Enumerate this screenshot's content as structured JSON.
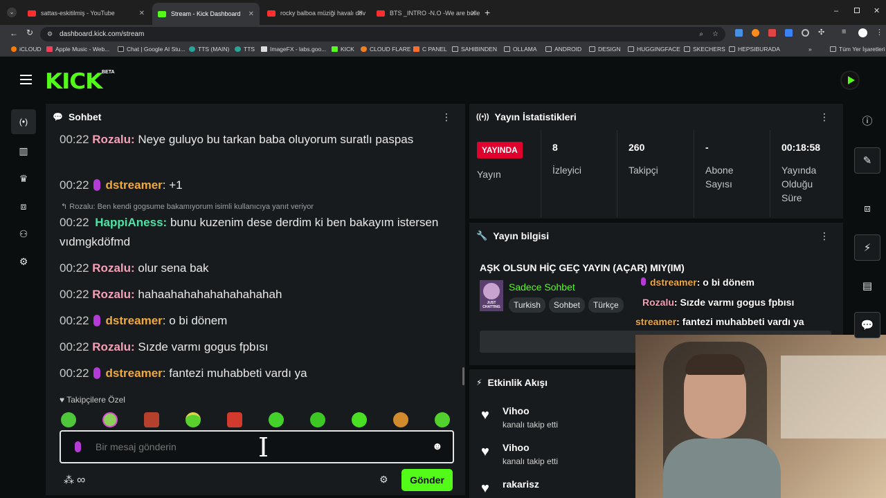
{
  "browser": {
    "tabs": [
      {
        "title": "sattas-eskitilmiş - YouTube",
        "color": "#ff2d2d"
      },
      {
        "title": "Stream - Kick Dashboard",
        "color": "#53fc18"
      },
      {
        "title": "rocky balboa müziği havalı döv",
        "color": "#ff2d2d"
      },
      {
        "title": "BTS _INTRO -N.O -We are bulle",
        "color": "#ff2d2d"
      }
    ],
    "url": "dashboard.kick.com/stream",
    "bookmarks": [
      {
        "label": "iCLOUD"
      },
      {
        "label": "Apple Music - Web..."
      },
      {
        "label": "Chat | Google AI Stu..."
      },
      {
        "label": "TTS (MAIN)"
      },
      {
        "label": "TTS"
      },
      {
        "label": "ImageFX - labs.goo..."
      },
      {
        "label": "KICK"
      },
      {
        "label": "CLOUD FLARE"
      },
      {
        "label": "C PANEL"
      },
      {
        "label": "SAHIBINDEN"
      },
      {
        "label": "OLLAMA"
      },
      {
        "label": "ANDROID"
      },
      {
        "label": "DESIGN"
      },
      {
        "label": "HUGGINGFACE"
      },
      {
        "label": "SKECHERS"
      },
      {
        "label": "HEPSIBURADA"
      },
      {
        "label": "Tüm Yer İşaretleri"
      }
    ]
  },
  "app": {
    "logo": "KICK",
    "beta": "BETA"
  },
  "chat": {
    "title": "Sohbet",
    "reply_text": "Rozalu: Ben kendi gogsume bakamıyorum isimli kullanıcıya yanıt veriyor",
    "messages": [
      {
        "time": "00:22",
        "user": "Rozalu:",
        "text": "Neye guluyo bu tarkan baba oluyorum suratlı paspas"
      },
      {
        "time": "00:22",
        "user": "dstreamer",
        "text": ": +1"
      },
      {
        "time": "00:22",
        "user": "HappiAness:",
        "text": "bunu kuzenim dese derdim ki ben bakayım istersen vıdmgkdöfmd"
      },
      {
        "time": "00:22",
        "user": "Rozalu:",
        "text": "olur sena bak"
      },
      {
        "time": "00:22",
        "user": "Rozalu:",
        "text": "hahaahahahahahahahahah"
      },
      {
        "time": "00:22",
        "user": "dstreamer",
        "text": ": o bi dönem"
      },
      {
        "time": "00:22",
        "user": "Rozalu:",
        "text": "Sızde varmı gogus fpbısı"
      },
      {
        "time": "00:22",
        "user": "dstreamer",
        "text": ": fantezi muhabbeti vardı ya"
      }
    ],
    "followers_only": "Takipçilere Özel",
    "input_placeholder": "Bir mesaj gönderin",
    "send_label": "Gönder"
  },
  "stats": {
    "title": "Yayın İstatistikleri",
    "live_badge": "YAYINDA",
    "live_label": "Yayın",
    "items": [
      {
        "value": "8",
        "label": "İzleyici"
      },
      {
        "value": "260",
        "label": "Takipçi"
      },
      {
        "value": "-",
        "label": "Abone Sayısı"
      },
      {
        "value": "00:18:58",
        "label": "Yayında Olduğu Süre"
      }
    ]
  },
  "info": {
    "title": "Yayın bilgisi",
    "stream_title": "AŞK OLSUN HİÇ GEÇ YAYIN (AÇAR) MIY(IM)",
    "category": "Sadece Sohbet",
    "category_thumb_text": "JUST CHATTING",
    "tags": [
      "Turkish",
      "Sohbet",
      "Türkçe"
    ]
  },
  "overlay_chat": [
    {
      "user": "dstreamer",
      "text": ": o bi dönem"
    },
    {
      "user": "Rozalu",
      "text": ": Sızde varmı gogus fpbısı"
    },
    {
      "user": "streamer",
      "text": ": fantezi muhabbeti vardı ya"
    }
  ],
  "activity": {
    "title": "Etkinlik Akışı",
    "items": [
      {
        "name": "Vihoo",
        "sub": "kanalı takip etti"
      },
      {
        "name": "Vihoo",
        "sub": "kanalı takip etti"
      },
      {
        "name": "rakarisz",
        "sub": ""
      }
    ]
  },
  "colors": {
    "accent": "#53fc18",
    "live": "#e0002d"
  }
}
